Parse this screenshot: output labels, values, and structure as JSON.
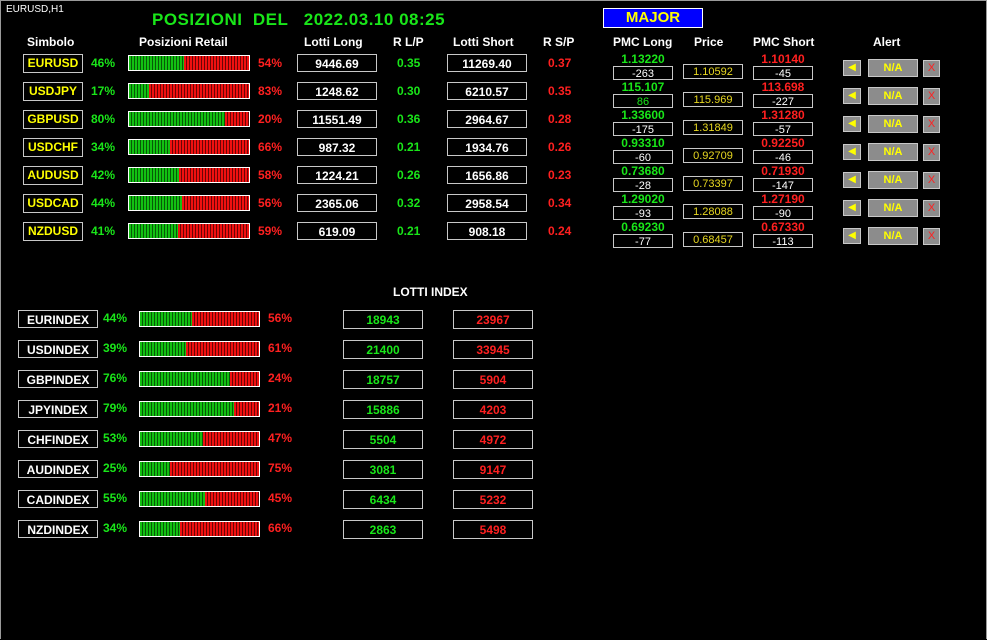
{
  "chart_label": "EURUSD,H1",
  "title": "POSIZIONI  DEL   2022.03.10 08:25",
  "major_button": "MAJOR",
  "headers": {
    "simbolo": "Simbolo",
    "posizioni_retail": "Posizioni Retail",
    "lotti_long": "Lotti Long",
    "r_lp": "R L/P",
    "lotti_short": "Lotti Short",
    "r_sp": "R S/P",
    "pmc_long": "PMC Long",
    "price": "Price",
    "pmc_short": "PMC Short",
    "alert": "Alert"
  },
  "pairs": [
    {
      "symbol": "EURUSD",
      "long_pct": 46,
      "long_label": "46%",
      "short_label": "54%",
      "lotti_long": "9446.69",
      "r_lp": "0.35",
      "lotti_short": "11269.40",
      "r_sp": "0.37",
      "pmc_long": "1.13220",
      "pmc_long_diff": "-263",
      "price": "1.10592",
      "pmc_short": "1.10140",
      "pmc_short_diff": "-45",
      "alert": "N/A",
      "bell": "◀",
      "x": "X"
    },
    {
      "symbol": "USDJPY",
      "long_pct": 17,
      "long_label": "17%",
      "short_label": "83%",
      "lotti_long": "1248.62",
      "r_lp": "0.30",
      "lotti_short": "6210.57",
      "r_sp": "0.35",
      "pmc_long": "115.107",
      "pmc_long_diff": "86",
      "price": "115.969",
      "pmc_short": "113.698",
      "pmc_short_diff": "-227",
      "alert": "N/A",
      "bell": "◀",
      "x": "X"
    },
    {
      "symbol": "GBPUSD",
      "long_pct": 80,
      "long_label": "80%",
      "short_label": "20%",
      "lotti_long": "11551.49",
      "r_lp": "0.36",
      "lotti_short": "2964.67",
      "r_sp": "0.28",
      "pmc_long": "1.33600",
      "pmc_long_diff": "-175",
      "price": "1.31849",
      "pmc_short": "1.31280",
      "pmc_short_diff": "-57",
      "alert": "N/A",
      "bell": "◀",
      "x": "X"
    },
    {
      "symbol": "USDCHF",
      "long_pct": 34,
      "long_label": "34%",
      "short_label": "66%",
      "lotti_long": "987.32",
      "r_lp": "0.21",
      "lotti_short": "1934.76",
      "r_sp": "0.26",
      "pmc_long": "0.93310",
      "pmc_long_diff": "-60",
      "price": "0.92709",
      "pmc_short": "0.92250",
      "pmc_short_diff": "-46",
      "alert": "N/A",
      "bell": "◀",
      "x": "X"
    },
    {
      "symbol": "AUDUSD",
      "long_pct": 42,
      "long_label": "42%",
      "short_label": "58%",
      "lotti_long": "1224.21",
      "r_lp": "0.26",
      "lotti_short": "1656.86",
      "r_sp": "0.23",
      "pmc_long": "0.73680",
      "pmc_long_diff": "-28",
      "price": "0.73397",
      "pmc_short": "0.71930",
      "pmc_short_diff": "-147",
      "alert": "N/A",
      "bell": "◀",
      "x": "X"
    },
    {
      "symbol": "USDCAD",
      "long_pct": 44,
      "long_label": "44%",
      "short_label": "56%",
      "lotti_long": "2365.06",
      "r_lp": "0.32",
      "lotti_short": "2958.54",
      "r_sp": "0.34",
      "pmc_long": "1.29020",
      "pmc_long_diff": "-93",
      "price": "1.28088",
      "pmc_short": "1.27190",
      "pmc_short_diff": "-90",
      "alert": "N/A",
      "bell": "◀",
      "x": "X"
    },
    {
      "symbol": "NZDUSD",
      "long_pct": 41,
      "long_label": "41%",
      "short_label": "59%",
      "lotti_long": "619.09",
      "r_lp": "0.21",
      "lotti_short": "908.18",
      "r_sp": "0.24",
      "pmc_long": "0.69230",
      "pmc_long_diff": "-77",
      "price": "0.68457",
      "pmc_short": "0.67330",
      "pmc_short_diff": "-113",
      "alert": "N/A",
      "bell": "◀",
      "x": "X"
    }
  ],
  "lotti_index_title": "LOTTI INDEX",
  "indices": [
    {
      "name": "EURINDEX",
      "long_pct": 44,
      "long_label": "44%",
      "short_label": "56%",
      "long_lots": "18943",
      "short_lots": "23967"
    },
    {
      "name": "USDINDEX",
      "long_pct": 39,
      "long_label": "39%",
      "short_label": "61%",
      "long_lots": "21400",
      "short_lots": "33945"
    },
    {
      "name": "GBPINDEX",
      "long_pct": 76,
      "long_label": "76%",
      "short_label": "24%",
      "long_lots": "18757",
      "short_lots": "5904"
    },
    {
      "name": "JPYINDEX",
      "long_pct": 79,
      "long_label": "79%",
      "short_label": "21%",
      "long_lots": "15886",
      "short_lots": "4203"
    },
    {
      "name": "CHFINDEX",
      "long_pct": 53,
      "long_label": "53%",
      "short_label": "47%",
      "long_lots": "5504",
      "short_lots": "4972"
    },
    {
      "name": "AUDINDEX",
      "long_pct": 25,
      "long_label": "25%",
      "short_label": "75%",
      "long_lots": "3081",
      "short_lots": "9147"
    },
    {
      "name": "CADINDEX",
      "long_pct": 55,
      "long_label": "55%",
      "short_label": "45%",
      "long_lots": "6434",
      "short_lots": "5232"
    },
    {
      "name": "NZDINDEX",
      "long_pct": 34,
      "long_label": "34%",
      "short_label": "66%",
      "long_lots": "2863",
      "short_lots": "5498"
    }
  ],
  "colors": {
    "green": "#19e619",
    "red": "#ff2020",
    "yellow": "#ffff00",
    "major_bg": "#0000ff"
  }
}
